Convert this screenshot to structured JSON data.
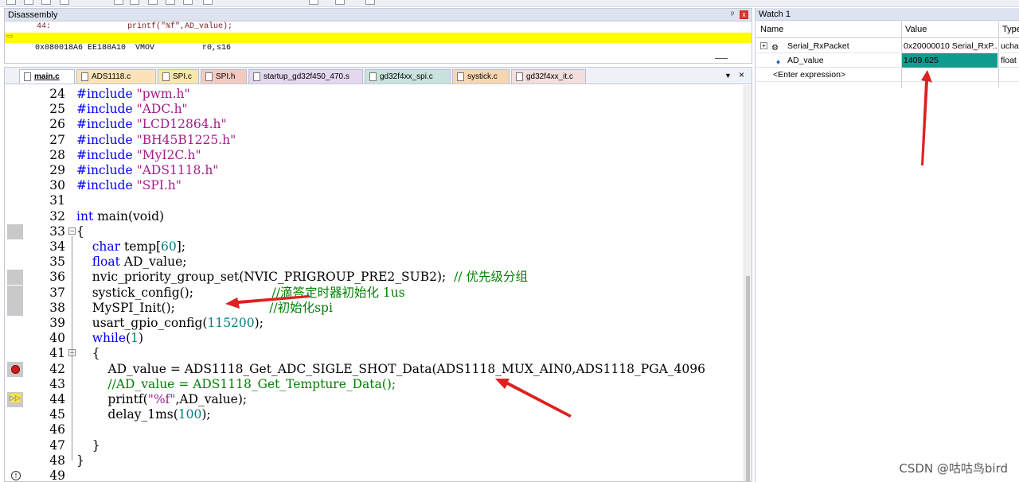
{
  "disassembly": {
    "title": "Disassembly",
    "pin": "ᵖ",
    "close": "x",
    "source_line": "44:                printf(\"%f\",AD_value);",
    "current_line": "0x080018A6 EE180A10  VMOV          r0,s16"
  },
  "tabs": [
    {
      "label": "main.c",
      "color": "#ffffff",
      "active": true
    },
    {
      "label": "ADS1118.c",
      "color": "#fbe3b7"
    },
    {
      "label": "SPI.c",
      "color": "#f7e7ad"
    },
    {
      "label": "SPI.h",
      "color": "#f4c9c0"
    },
    {
      "label": "startup_gd32f450_470.s",
      "color": "#e3d8ee"
    },
    {
      "label": "gd32f4xx_spi.c",
      "color": "#c9e3dc"
    },
    {
      "label": "systick.c",
      "color": "#f7d6b2"
    },
    {
      "label": "gd32f4xx_it.c",
      "color": "#f3dede"
    }
  ],
  "tab_controls": {
    "dropdown": "▼",
    "close": "×"
  },
  "code_lines": [
    {
      "n": "24",
      "parts": [
        [
          "pp",
          "#include "
        ],
        [
          "str",
          "\"pwm.h\""
        ]
      ]
    },
    {
      "n": "25",
      "parts": [
        [
          "pp",
          "#include "
        ],
        [
          "str",
          "\"ADC.h\""
        ]
      ]
    },
    {
      "n": "26",
      "parts": [
        [
          "pp",
          "#include "
        ],
        [
          "str",
          "\"LCD12864.h\""
        ]
      ]
    },
    {
      "n": "27",
      "parts": [
        [
          "pp",
          "#include "
        ],
        [
          "str",
          "\"BH45B1225.h\""
        ]
      ]
    },
    {
      "n": "28",
      "parts": [
        [
          "pp",
          "#include "
        ],
        [
          "str",
          "\"MyI2C.h\""
        ]
      ]
    },
    {
      "n": "29",
      "parts": [
        [
          "pp",
          "#include "
        ],
        [
          "str",
          "\"ADS1118.h\""
        ]
      ]
    },
    {
      "n": "30",
      "parts": [
        [
          "pp",
          "#include "
        ],
        [
          "str",
          "\"SPI.h\""
        ]
      ]
    },
    {
      "n": "31",
      "parts": []
    },
    {
      "n": "32",
      "parts": [
        [
          "kw",
          "int"
        ],
        [
          "",
          " main(void)"
        ]
      ]
    },
    {
      "n": "33",
      "parts": [
        [
          "",
          "{"
        ]
      ],
      "fold": "⊟"
    },
    {
      "n": "34",
      "parts": [
        [
          "",
          "    "
        ],
        [
          "kw",
          "char"
        ],
        [
          "",
          " temp["
        ],
        [
          "num",
          "60"
        ],
        [
          "",
          "];"
        ]
      ]
    },
    {
      "n": "35",
      "parts": [
        [
          "",
          "    "
        ],
        [
          "kw",
          "float"
        ],
        [
          "",
          " AD_value;"
        ]
      ]
    },
    {
      "n": "36",
      "parts": [
        [
          "",
          "    nvic_priority_group_set(NVIC_PRIGROUP_PRE2_SUB2);  "
        ],
        [
          "cmt",
          "// 优先级分组"
        ]
      ]
    },
    {
      "n": "37",
      "parts": [
        [
          "",
          "    systick_config();                    "
        ],
        [
          "cmt",
          "//滴答定时器初始化 1us"
        ]
      ]
    },
    {
      "n": "38",
      "parts": [
        [
          "",
          "    MySPI_Init();                        "
        ],
        [
          "cmt",
          "//初始化spi"
        ]
      ]
    },
    {
      "n": "39",
      "parts": [
        [
          "",
          "    usart_gpio_config("
        ],
        [
          "num",
          "115200"
        ],
        [
          "",
          ");"
        ]
      ]
    },
    {
      "n": "40",
      "parts": [
        [
          "",
          "    "
        ],
        [
          "kw",
          "while"
        ],
        [
          "",
          "("
        ],
        [
          "num",
          "1"
        ],
        [
          "",
          ")"
        ]
      ]
    },
    {
      "n": "41",
      "parts": [
        [
          "",
          "    {"
        ]
      ],
      "fold": "⊟"
    },
    {
      "n": "42",
      "parts": [
        [
          "",
          "        AD_value = ADS1118_Get_ADC_SIGLE_SHOT_Data(ADS1118_MUX_AIN0,ADS1118_PGA_4096"
        ]
      ],
      "marker": "breakpoint"
    },
    {
      "n": "43",
      "parts": [
        [
          "",
          "        "
        ],
        [
          "cmt",
          "//AD_value = ADS1118_Get_Tempture_Data();"
        ]
      ]
    },
    {
      "n": "44",
      "parts": [
        [
          "",
          "        printf("
        ],
        [
          "str",
          "\"%f\""
        ],
        [
          "",
          ",AD_value);"
        ]
      ],
      "marker": "current"
    },
    {
      "n": "45",
      "parts": [
        [
          "",
          "        delay_1ms("
        ],
        [
          "num",
          "100"
        ],
        [
          "",
          ");"
        ]
      ]
    },
    {
      "n": "46",
      "parts": []
    },
    {
      "n": "47",
      "parts": [
        [
          "",
          "    }"
        ]
      ]
    },
    {
      "n": "48",
      "parts": [
        [
          "",
          "}"
        ]
      ]
    },
    {
      "n": "49",
      "parts": [],
      "marker": "warning"
    }
  ],
  "gray_margin_lines": [
    "33",
    "36",
    "37",
    "38",
    "42",
    "44"
  ],
  "watch": {
    "title": "Watch 1",
    "columns": {
      "name": "Name",
      "value": "Value",
      "type": "Type"
    },
    "rows": [
      {
        "name": "Serial_RxPacket",
        "value": "0x20000010 Serial_RxP...",
        "type": "ucha",
        "expandable": "⊞"
      },
      {
        "name": "AD_value",
        "value": "1409.625",
        "type": "float",
        "selected": true
      },
      {
        "name": "<Enter expression>",
        "value": "",
        "type": ""
      }
    ]
  },
  "colors": {
    "accent_yellow": "#ffff00",
    "annotation_red": "#e02020",
    "value_highlight": "#0f9b8e"
  },
  "watermark": "CSDN @咕咕鸟bird"
}
